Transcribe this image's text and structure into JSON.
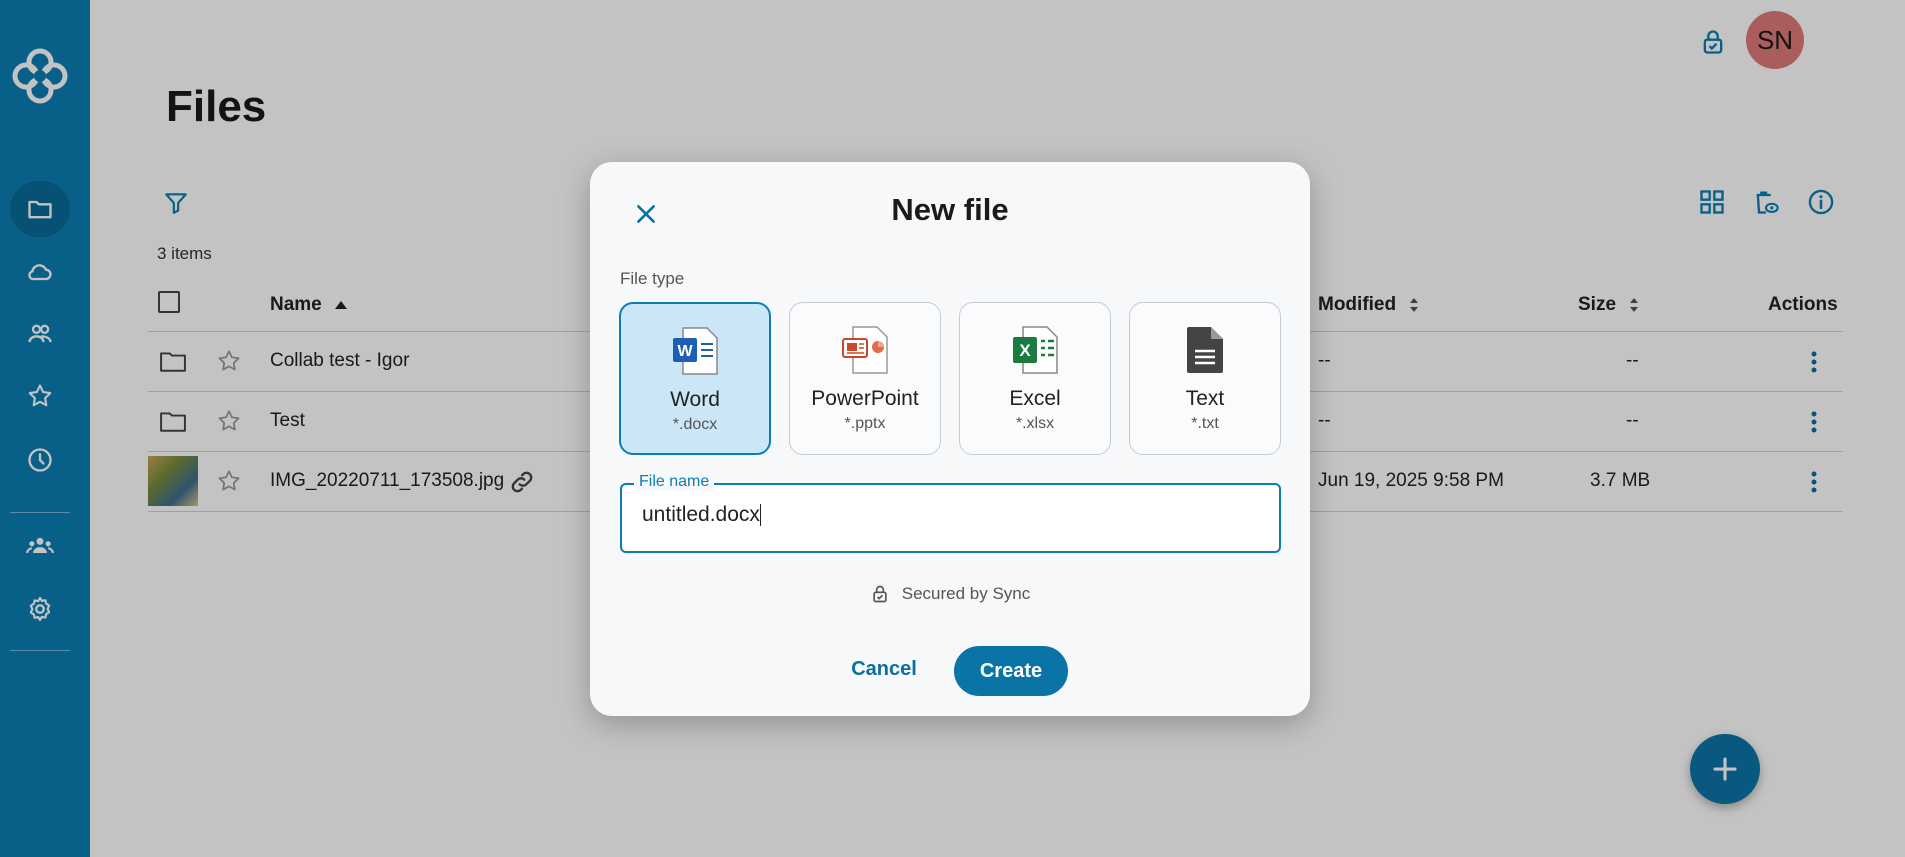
{
  "app": {
    "title": "Files",
    "items_count": "3 items",
    "avatar_initials": "SN",
    "accent_color": "#0b7eb3",
    "avatar_color": "#e07a7a"
  },
  "sidebar": {
    "items": [
      {
        "icon": "folder-icon",
        "active": true
      },
      {
        "icon": "cloud-icon",
        "active": false
      },
      {
        "icon": "users-icon",
        "active": false
      },
      {
        "icon": "star-icon",
        "active": false
      },
      {
        "icon": "clock-icon",
        "active": false
      },
      {
        "icon": "team-icon",
        "active": false
      },
      {
        "icon": "gear-icon",
        "active": false
      }
    ]
  },
  "table": {
    "headers": {
      "name": "Name",
      "modified": "Modified",
      "size": "Size",
      "actions": "Actions"
    },
    "rows": [
      {
        "name": "Collab test - Igor",
        "modified": "--",
        "size": "--",
        "type": "folder"
      },
      {
        "name": "Test",
        "modified": "--",
        "size": "--",
        "type": "folder"
      },
      {
        "name": "IMG_20220711_173508.jpg",
        "modified": "Jun 19, 2025 9:58 PM",
        "size": "3.7 MB",
        "type": "image"
      }
    ]
  },
  "dialog": {
    "title": "New file",
    "file_type_label": "File type",
    "types": [
      {
        "name": "Word",
        "ext": "*.docx",
        "selected": true,
        "icon": "word-icon"
      },
      {
        "name": "PowerPoint",
        "ext": "*.pptx",
        "selected": false,
        "icon": "powerpoint-icon"
      },
      {
        "name": "Excel",
        "ext": "*.xlsx",
        "selected": false,
        "icon": "excel-icon"
      },
      {
        "name": "Text",
        "ext": "*.txt",
        "selected": false,
        "icon": "text-file-icon"
      }
    ],
    "file_name_label": "File name",
    "file_name_value": "untitled.docx",
    "secured_text": "Secured by Sync",
    "cancel_label": "Cancel",
    "create_label": "Create"
  }
}
